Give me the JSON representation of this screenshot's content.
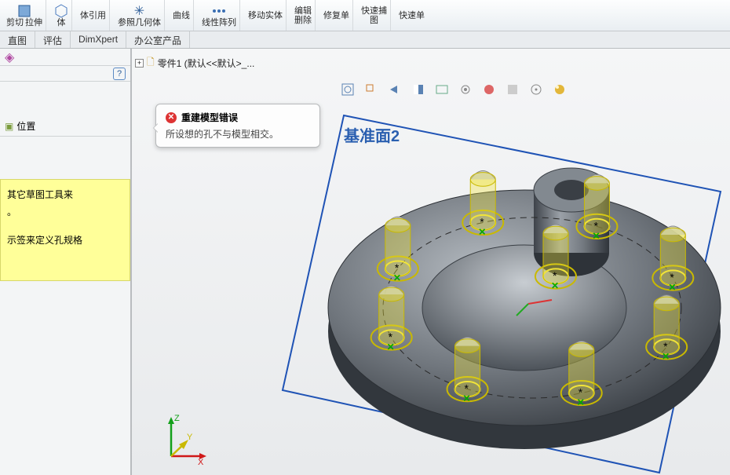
{
  "ribbon": {
    "group1_labels": [
      "剪切",
      "拉伸"
    ],
    "group2": "体",
    "group3": "体引用",
    "group4": "参照几何体",
    "group5": "曲线",
    "group6": "线性阵列",
    "group7": "移动实体",
    "group8_top": "编辑",
    "group8_bot": "删除",
    "group9": "修复单",
    "group10_top": "快速捕",
    "group10_bot": "图",
    "group11": "快速单"
  },
  "tabs": [
    "直图",
    "评估",
    "DimXpert",
    "办公室产品"
  ],
  "side": {
    "loc_label": "位置",
    "tip1": "其它草图工具来",
    "tip1b": "。",
    "tip2": "示签来定义孔规格"
  },
  "crumb": {
    "text": "零件1 (默认<<默认>_..."
  },
  "tooltip": {
    "title": "重建模型错误",
    "msg": "所设想的孔不与模型相交。"
  },
  "plane": "基准面2",
  "viewtools": {
    "items": [
      "zoom-fit",
      "zoom-window",
      "prev-view",
      "section",
      "display-style",
      "hide-show",
      "edit-appearance",
      "apply-scene",
      "view-settings",
      "render"
    ]
  },
  "triad": {
    "x": "X",
    "y": "Y",
    "z": "Z"
  },
  "colors": {
    "plane": "#2a5fb0",
    "holeRing": "#f2e43a",
    "holeRingDark": "#c9b900",
    "partDark": "#4a4f55",
    "partLight": "#9aa0a6",
    "sketchBlue": "#1f53b5"
  }
}
